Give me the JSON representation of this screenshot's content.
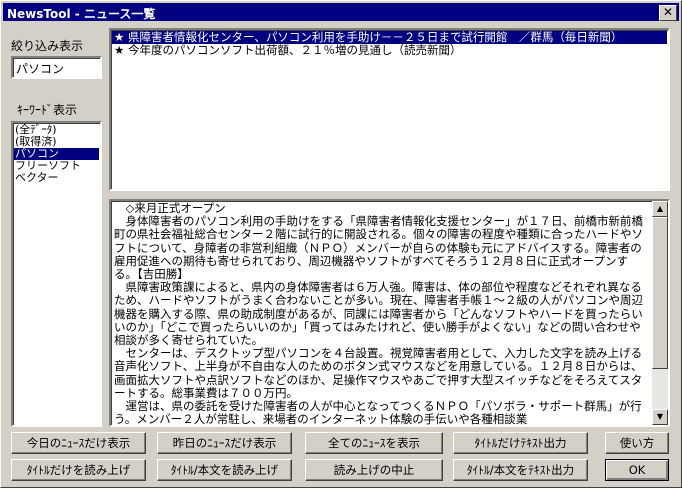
{
  "window": {
    "title": "NewsTool - ニュース一覧",
    "close_glyph": "✕"
  },
  "filter": {
    "label": "絞り込み表示",
    "value": "パソコン"
  },
  "keywords": {
    "label": "ｷｰﾜｰﾄﾞ表示",
    "items": [
      "(全ﾃﾞｰﾀ)",
      "(取得済)",
      "パソコン",
      "フリーソフト",
      "ベクター"
    ],
    "selected_index": 2
  },
  "headlines": {
    "items": [
      "★ 県障害者情報化センター、パソコン利用を手助け－－２５日まで試行開館　／群馬（毎日新聞）",
      "★ 今年度のパソコンソフト出荷額、２１％増の見通し（読売新聞）"
    ],
    "selected_index": 0
  },
  "article": {
    "text": "　◇来月正式オープン\n　身体障害者のパソコン利用の手助けをする「県障害者情報化支援センター」が１７日、前橋市新前橋町の県社会福祉総合センター２階に試行的に開設される。個々の障害の程度や種類に合ったハードやソフトについて、身障者の非営利組織（ＮＰＯ）メンバーが自らの体験も元にアドバイスする。障害者の雇用促進への期待も寄せられており、周辺機器やソフトがすべてそろう１２月８日に正式オープンする。【吉田勝】\n　県障害政策課によると、県内の身体障害者は６万人強。障害は、体の部位や程度などそれぞれ異なるため、ハードやソフトがうまく合わないことが多い。現在、障害者手帳１～２級の人がパソコンや周辺機器を購入する際、県の助成制度があるが、同課には障害者から「どんなソフトやハードを買ったらいいのか」「どこで買ったらいいのか」「買ってはみたけれど、使い勝手がよくない」などの問い合わせや相談が多く寄せられていた。\n　センターは、デスクトップ型パソコンを４台設置。視覚障害者用として、入力した文字を読み上げる音声化ソフト、上半身が不自由な人のためのボタン式マウスなどを用意している。１２月８日からは、画面拡大ソフトや点訳ソフトなどのほか、足操作マウスやあごで押す大型スイッチなどをそろえてスタートする。総事業費は７００万円。\n　運営は、県の委託を受けた障害者の人が中心となってつくるＮＰＯ「パソボラ・サポート群馬」が行う。メンバー２人が常駐し、来場者のインターネット体験の手伝いや各種相談業"
  },
  "buttons": {
    "today_news": "今日のﾆｭｰｽだけ表示",
    "yesterday_news": "昨日のﾆｭｰｽだけ表示",
    "all_news": "全てのﾆｭｰｽを表示",
    "titles_to_text": "ﾀｲﾄﾙだけﾃｷｽﾄ出力",
    "usage": "使い方",
    "read_titles": "ﾀｲﾄﾙだけを読み上げ",
    "read_title_body": "ﾀｲﾄﾙ/本文を読み上げ",
    "stop_reading": "読み上げの中止",
    "title_body_to_text": "ﾀｲﾄﾙ/本文をﾃｷｽﾄ出力",
    "ok": "OK"
  }
}
